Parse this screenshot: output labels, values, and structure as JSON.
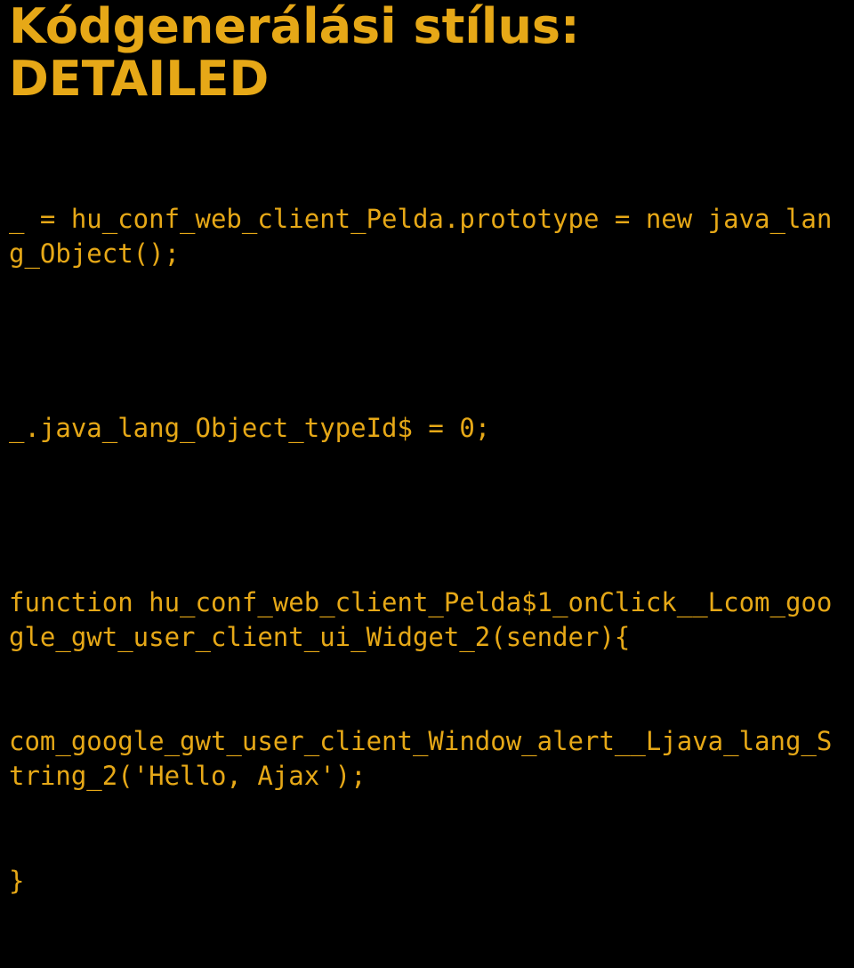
{
  "slide": {
    "title": "Kódgenerálási stílus: DETAILED",
    "code": {
      "line1": "_ = hu_conf_web_client_Pelda.prototype = new java_lang_Object();",
      "blank1": "",
      "line2": "_.java_lang_Object_typeId$ = 0;",
      "blank2": "",
      "line3": "function hu_conf_web_client_Pelda$1_onClick__Lcom_google_gwt_user_client_ui_Widget_2(sender){",
      "line4": "com_google_gwt_user_client_Window_alert__Ljava_lang_String_2('Hello, Ajax');",
      "line5": "}"
    }
  }
}
